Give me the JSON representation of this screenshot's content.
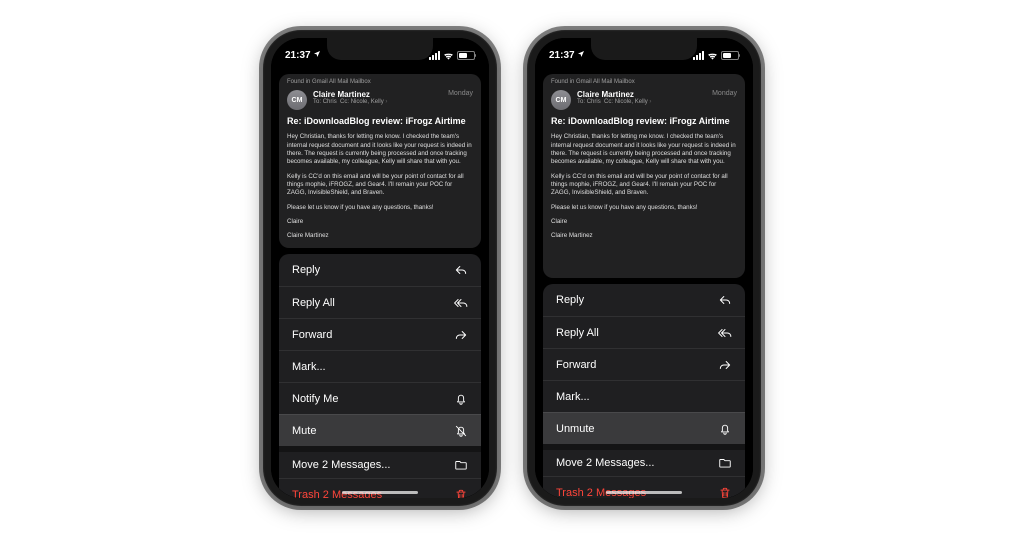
{
  "status": {
    "time": "21:37",
    "loc_icon": "location-icon"
  },
  "card": {
    "found": "Found in Gmail All Mail Mailbox",
    "avatar": "CM",
    "from": "Claire Martinez",
    "to_label": "To:",
    "to": "Chris",
    "cc_label": "Cc:",
    "cc": "Nicole, Kelly",
    "date": "Monday",
    "subject": "Re:  iDownloadBlog review: iFrogz Airtime",
    "p1": "Hey Christian, thanks for letting me know. I checked the team's internal request document and it looks like your request is indeed in there. The request is currently being processed and once tracking becomes available, my colleague, Kelly will share that with you.",
    "p2": "Kelly is CC'd on this email and will be your point of contact for all things mophie, iFROGZ, and Gear4. I'll remain your POC for ZAGG, InvisibleShield, and Braven.",
    "p3": "Please let us know if you have any questions, thanks!",
    "sig1": "Claire",
    "sig2": "Claire Martinez"
  },
  "menu": {
    "reply": "Reply",
    "reply_all": "Reply All",
    "forward": "Forward",
    "mark": "Mark...",
    "notify": "Notify Me",
    "mute": "Mute",
    "unmute": "Unmute",
    "move": "Move 2 Messages...",
    "trash": "Trash 2 Messages"
  }
}
